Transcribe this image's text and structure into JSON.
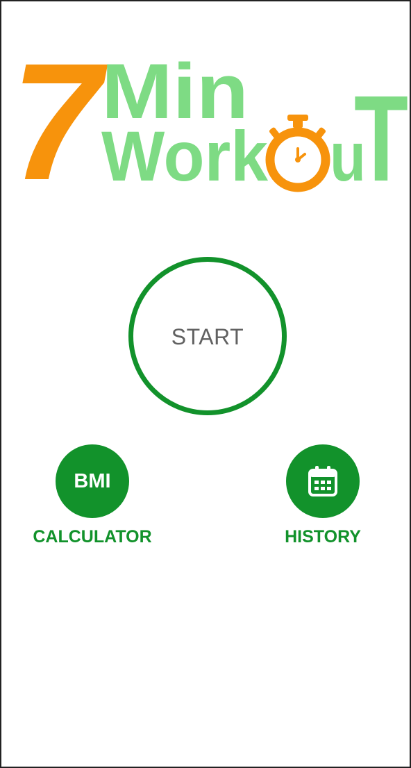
{
  "logo": {
    "number": "7",
    "word1": "Min",
    "word2": "Workout",
    "colors": {
      "orange": "#f7930c",
      "green": "#7edb84",
      "clock_face": "#ffffff"
    }
  },
  "start_button": {
    "label": "START"
  },
  "bmi": {
    "icon_text": "BMI",
    "caption": "CALCULATOR"
  },
  "history": {
    "icon": "calendar-icon",
    "caption": "HISTORY"
  },
  "colors": {
    "accent": "#12922b",
    "start_text": "#616161",
    "background": "#ffffff"
  }
}
